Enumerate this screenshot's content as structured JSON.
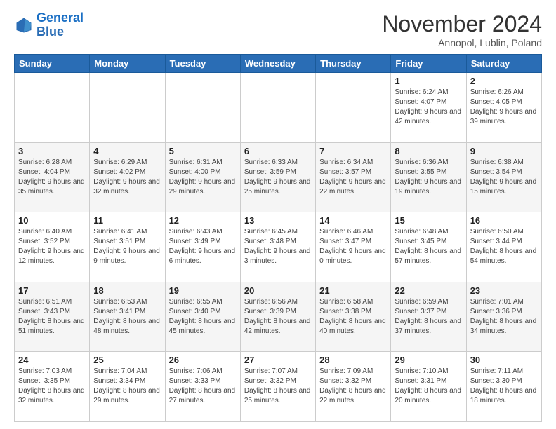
{
  "logo": {
    "line1": "General",
    "line2": "Blue"
  },
  "title": "November 2024",
  "location": "Annopol, Lublin, Poland",
  "days_header": [
    "Sunday",
    "Monday",
    "Tuesday",
    "Wednesday",
    "Thursday",
    "Friday",
    "Saturday"
  ],
  "weeks": [
    [
      {
        "num": "",
        "info": ""
      },
      {
        "num": "",
        "info": ""
      },
      {
        "num": "",
        "info": ""
      },
      {
        "num": "",
        "info": ""
      },
      {
        "num": "",
        "info": ""
      },
      {
        "num": "1",
        "info": "Sunrise: 6:24 AM\nSunset: 4:07 PM\nDaylight: 9 hours\nand 42 minutes."
      },
      {
        "num": "2",
        "info": "Sunrise: 6:26 AM\nSunset: 4:05 PM\nDaylight: 9 hours\nand 39 minutes."
      }
    ],
    [
      {
        "num": "3",
        "info": "Sunrise: 6:28 AM\nSunset: 4:04 PM\nDaylight: 9 hours\nand 35 minutes."
      },
      {
        "num": "4",
        "info": "Sunrise: 6:29 AM\nSunset: 4:02 PM\nDaylight: 9 hours\nand 32 minutes."
      },
      {
        "num": "5",
        "info": "Sunrise: 6:31 AM\nSunset: 4:00 PM\nDaylight: 9 hours\nand 29 minutes."
      },
      {
        "num": "6",
        "info": "Sunrise: 6:33 AM\nSunset: 3:59 PM\nDaylight: 9 hours\nand 25 minutes."
      },
      {
        "num": "7",
        "info": "Sunrise: 6:34 AM\nSunset: 3:57 PM\nDaylight: 9 hours\nand 22 minutes."
      },
      {
        "num": "8",
        "info": "Sunrise: 6:36 AM\nSunset: 3:55 PM\nDaylight: 9 hours\nand 19 minutes."
      },
      {
        "num": "9",
        "info": "Sunrise: 6:38 AM\nSunset: 3:54 PM\nDaylight: 9 hours\nand 15 minutes."
      }
    ],
    [
      {
        "num": "10",
        "info": "Sunrise: 6:40 AM\nSunset: 3:52 PM\nDaylight: 9 hours\nand 12 minutes."
      },
      {
        "num": "11",
        "info": "Sunrise: 6:41 AM\nSunset: 3:51 PM\nDaylight: 9 hours\nand 9 minutes."
      },
      {
        "num": "12",
        "info": "Sunrise: 6:43 AM\nSunset: 3:49 PM\nDaylight: 9 hours\nand 6 minutes."
      },
      {
        "num": "13",
        "info": "Sunrise: 6:45 AM\nSunset: 3:48 PM\nDaylight: 9 hours\nand 3 minutes."
      },
      {
        "num": "14",
        "info": "Sunrise: 6:46 AM\nSunset: 3:47 PM\nDaylight: 9 hours\nand 0 minutes."
      },
      {
        "num": "15",
        "info": "Sunrise: 6:48 AM\nSunset: 3:45 PM\nDaylight: 8 hours\nand 57 minutes."
      },
      {
        "num": "16",
        "info": "Sunrise: 6:50 AM\nSunset: 3:44 PM\nDaylight: 8 hours\nand 54 minutes."
      }
    ],
    [
      {
        "num": "17",
        "info": "Sunrise: 6:51 AM\nSunset: 3:43 PM\nDaylight: 8 hours\nand 51 minutes."
      },
      {
        "num": "18",
        "info": "Sunrise: 6:53 AM\nSunset: 3:41 PM\nDaylight: 8 hours\nand 48 minutes."
      },
      {
        "num": "19",
        "info": "Sunrise: 6:55 AM\nSunset: 3:40 PM\nDaylight: 8 hours\nand 45 minutes."
      },
      {
        "num": "20",
        "info": "Sunrise: 6:56 AM\nSunset: 3:39 PM\nDaylight: 8 hours\nand 42 minutes."
      },
      {
        "num": "21",
        "info": "Sunrise: 6:58 AM\nSunset: 3:38 PM\nDaylight: 8 hours\nand 40 minutes."
      },
      {
        "num": "22",
        "info": "Sunrise: 6:59 AM\nSunset: 3:37 PM\nDaylight: 8 hours\nand 37 minutes."
      },
      {
        "num": "23",
        "info": "Sunrise: 7:01 AM\nSunset: 3:36 PM\nDaylight: 8 hours\nand 34 minutes."
      }
    ],
    [
      {
        "num": "24",
        "info": "Sunrise: 7:03 AM\nSunset: 3:35 PM\nDaylight: 8 hours\nand 32 minutes."
      },
      {
        "num": "25",
        "info": "Sunrise: 7:04 AM\nSunset: 3:34 PM\nDaylight: 8 hours\nand 29 minutes."
      },
      {
        "num": "26",
        "info": "Sunrise: 7:06 AM\nSunset: 3:33 PM\nDaylight: 8 hours\nand 27 minutes."
      },
      {
        "num": "27",
        "info": "Sunrise: 7:07 AM\nSunset: 3:32 PM\nDaylight: 8 hours\nand 25 minutes."
      },
      {
        "num": "28",
        "info": "Sunrise: 7:09 AM\nSunset: 3:32 PM\nDaylight: 8 hours\nand 22 minutes."
      },
      {
        "num": "29",
        "info": "Sunrise: 7:10 AM\nSunset: 3:31 PM\nDaylight: 8 hours\nand 20 minutes."
      },
      {
        "num": "30",
        "info": "Sunrise: 7:11 AM\nSunset: 3:30 PM\nDaylight: 8 hours\nand 18 minutes."
      }
    ]
  ]
}
